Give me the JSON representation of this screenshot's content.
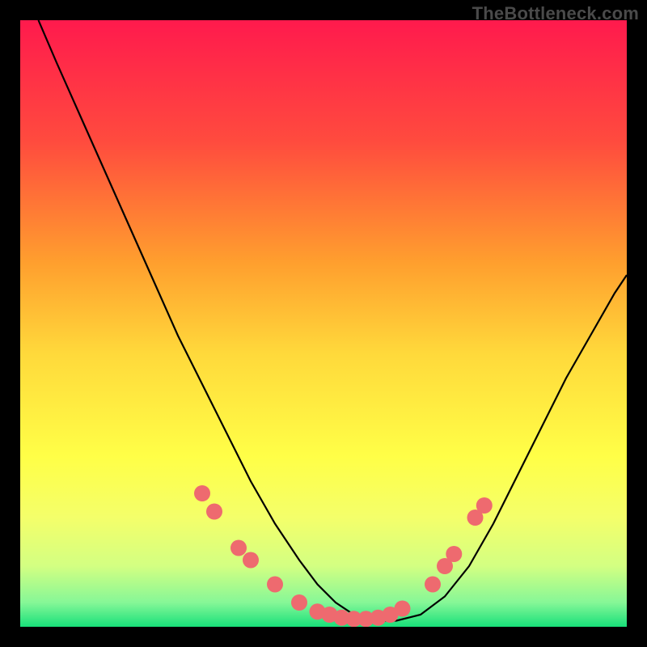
{
  "watermark": "TheBottleneck.com",
  "chart_data": {
    "type": "line",
    "title": "",
    "xlabel": "",
    "ylabel": "",
    "xlim": [
      0,
      100
    ],
    "ylim": [
      0,
      100
    ],
    "grid": false,
    "legend": false,
    "background_gradient": {
      "stops": [
        {
          "offset": 0.0,
          "color": "#ff1a4d"
        },
        {
          "offset": 0.2,
          "color": "#ff4b3e"
        },
        {
          "offset": 0.4,
          "color": "#ff9f2e"
        },
        {
          "offset": 0.55,
          "color": "#ffd93b"
        },
        {
          "offset": 0.72,
          "color": "#ffff47"
        },
        {
          "offset": 0.82,
          "color": "#f4ff6a"
        },
        {
          "offset": 0.9,
          "color": "#d3ff82"
        },
        {
          "offset": 0.96,
          "color": "#86f797"
        },
        {
          "offset": 1.0,
          "color": "#18e07a"
        }
      ]
    },
    "series": [
      {
        "name": "bottleneck-curve",
        "color": "#000000",
        "x": [
          3,
          6,
          10,
          14,
          18,
          22,
          26,
          30,
          34,
          38,
          42,
          46,
          49,
          52,
          55,
          58,
          62,
          66,
          70,
          74,
          78,
          82,
          86,
          90,
          94,
          98,
          100
        ],
        "y": [
          100,
          93,
          84,
          75,
          66,
          57,
          48,
          40,
          32,
          24,
          17,
          11,
          7,
          4,
          2,
          1,
          1,
          2,
          5,
          10,
          17,
          25,
          33,
          41,
          48,
          55,
          58
        ]
      }
    ],
    "markers": {
      "name": "highlight-dots",
      "color": "#ee6a6f",
      "radius_px": 10,
      "points": [
        {
          "x": 30,
          "y": 22
        },
        {
          "x": 32,
          "y": 19
        },
        {
          "x": 36,
          "y": 13
        },
        {
          "x": 38,
          "y": 11
        },
        {
          "x": 42,
          "y": 7
        },
        {
          "x": 46,
          "y": 4
        },
        {
          "x": 49,
          "y": 2.5
        },
        {
          "x": 51,
          "y": 2
        },
        {
          "x": 53,
          "y": 1.5
        },
        {
          "x": 55,
          "y": 1.3
        },
        {
          "x": 57,
          "y": 1.3
        },
        {
          "x": 59,
          "y": 1.5
        },
        {
          "x": 61,
          "y": 2
        },
        {
          "x": 63,
          "y": 3
        },
        {
          "x": 68,
          "y": 7
        },
        {
          "x": 70,
          "y": 10
        },
        {
          "x": 71.5,
          "y": 12
        },
        {
          "x": 75,
          "y": 18
        },
        {
          "x": 76.5,
          "y": 20
        }
      ]
    }
  }
}
